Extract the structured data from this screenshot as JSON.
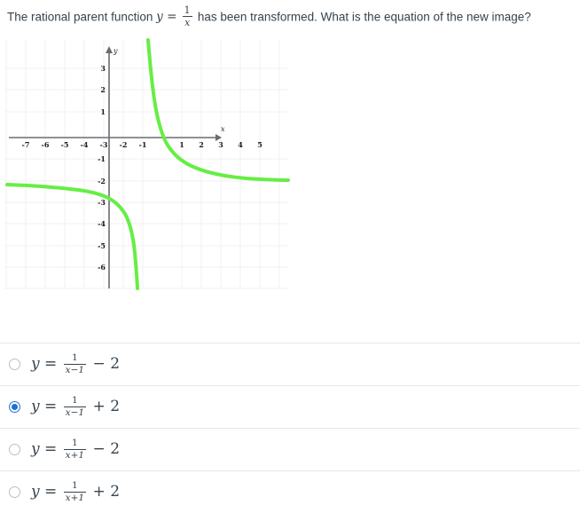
{
  "question": {
    "text_before": "The rational parent function",
    "equation_lhs": "y",
    "equation_eq": "=",
    "fraction_num": "1",
    "fraction_den": "x",
    "text_after": "has been transformed. What is the equation of the new image?"
  },
  "graph": {
    "x_axis_label": "x",
    "y_axis_label": "y",
    "x_ticks": [
      "-7",
      "-6",
      "-5",
      "-4",
      "-3",
      "-2",
      "-1",
      "1",
      "2",
      "3",
      "4",
      "5"
    ],
    "y_ticks": [
      "3",
      "2",
      "1",
      "-1",
      "-2",
      "-3",
      "-4",
      "-5",
      "-6"
    ],
    "curve_color": "#66ee44",
    "axis_color": "#6b6b72",
    "grid_color": "#f0f0f2",
    "tick_label_color": "#1d1d1d"
  },
  "chart_data": {
    "type": "line",
    "title": "",
    "xlabel": "x",
    "ylabel": "y",
    "xlim": [
      -7.9,
      5.7
    ],
    "ylim": [
      -6.9,
      3.8
    ],
    "grid": true,
    "legend": "none",
    "annotations": [
      "vertical asymptote at x = -1",
      "horizontal asymptote at y = -2"
    ],
    "series": [
      {
        "name": "y = 1/(x+1) - 2",
        "branch": "left",
        "x": [
          -7.9,
          -7.0,
          -6.0,
          -5.0,
          -4.0,
          -3.5,
          -3.0,
          -2.6,
          -2.3,
          -2.0,
          -1.8,
          -1.6,
          -1.45,
          -1.33,
          -1.25,
          -1.18,
          -1.13,
          -1.09,
          -1.06
        ],
        "y": [
          -2.14,
          -2.17,
          -2.2,
          -2.25,
          -2.33,
          -2.4,
          -2.5,
          -2.63,
          -2.77,
          -3.0,
          -3.25,
          -3.67,
          -4.22,
          -5.03,
          -6.0,
          -6.56,
          -8.69,
          -12.1,
          -18.7
        ]
      },
      {
        "name": "y = 1/(x+1) - 2",
        "branch": "right",
        "x": [
          -0.75,
          -0.72,
          -0.68,
          -0.64,
          -0.6,
          -0.55,
          -0.5,
          -0.4,
          -0.3,
          -0.2,
          -0.1,
          0.0,
          0.5,
          1.0,
          1.5,
          2.0,
          2.5,
          3.0,
          3.5,
          4.0,
          4.5,
          5.0,
          5.7
        ],
        "y": [
          2.0,
          1.57,
          1.13,
          0.78,
          0.5,
          0.22,
          0.0,
          -0.33,
          -0.57,
          -0.75,
          -0.89,
          -1.0,
          -1.33,
          -1.5,
          -1.6,
          -1.67,
          -1.71,
          -1.75,
          -1.78,
          -1.8,
          -1.82,
          -1.83,
          -1.85
        ]
      }
    ]
  },
  "answers": [
    {
      "id": "option-a",
      "selected": false,
      "lhs": "y",
      "eq": "=",
      "num": "1",
      "den": "x−1",
      "sign": "−",
      "constant": "2",
      "plain": "y = 1/(x-1) - 2"
    },
    {
      "id": "option-b",
      "selected": true,
      "lhs": "y",
      "eq": "=",
      "num": "1",
      "den": "x−1",
      "sign": "+",
      "constant": "2",
      "plain": "y = 1/(x-1) + 2"
    },
    {
      "id": "option-c",
      "selected": false,
      "lhs": "y",
      "eq": "=",
      "num": "1",
      "den": "x+1",
      "sign": "−",
      "constant": "2",
      "plain": "y = 1/(x+1) - 2"
    },
    {
      "id": "option-d",
      "selected": false,
      "lhs": "y",
      "eq": "=",
      "num": "1",
      "den": "x+1",
      "sign": "+",
      "constant": "2",
      "plain": "y = 1/(x+1) + 2"
    }
  ]
}
